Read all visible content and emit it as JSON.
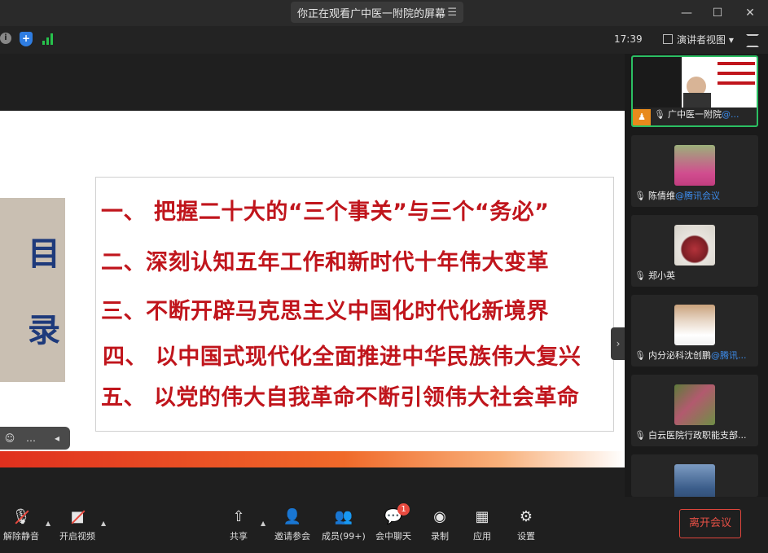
{
  "window": {
    "title": "你正在观看广中医一附院的屏幕",
    "list_icon": "list-icon",
    "controls": [
      "minimize-icon",
      "maximize-icon",
      "close-icon"
    ]
  },
  "status": {
    "time": "17:39",
    "view_label": "演讲者视图",
    "icons": [
      "info-icon",
      "shield-icon",
      "signal-icon",
      "fullscreen-icon"
    ]
  },
  "slide": {
    "toc_chars": [
      "目",
      "录"
    ],
    "items": [
      "一、  把握二十大的“三个事关”与三个“务必”",
      "二、深刻认知五年工作和新时代十年伟大变革",
      "三、不断开辟马克思主义中国化时代化新境界",
      "四、  以中国式现代化全面推进中华民族伟大复兴",
      "五、  以党的伟大自我革命不断引领伟大社会革命"
    ],
    "accent_red": "#c0151c",
    "toc_blue": "#1e3a7b"
  },
  "participants": [
    {
      "name": "广中医一附院",
      "tag": "@...",
      "host": true
    },
    {
      "name": "陈倩维",
      "tag": "@腾讯会议",
      "host": false
    },
    {
      "name": "郑小英",
      "tag": "",
      "host": false
    },
    {
      "name": "内分泌科沈创鹏",
      "tag": "@腾讯...",
      "host": false
    },
    {
      "name": "白云医院行政职能支部...",
      "tag": "",
      "host": false
    }
  ],
  "toolbar": {
    "unmute": "解除静音",
    "start_video": "开启视频",
    "share": "共享",
    "invite": "邀请参会",
    "members": "成员(99+)",
    "chat": "会中聊天",
    "chat_badge": "1",
    "record": "录制",
    "apps": "应用",
    "settings": "设置",
    "leave": "离开会议"
  },
  "colors": {
    "leave_red": "#e0463c",
    "active_green": "#2bbf63",
    "tag_blue": "#3d8ef0"
  }
}
